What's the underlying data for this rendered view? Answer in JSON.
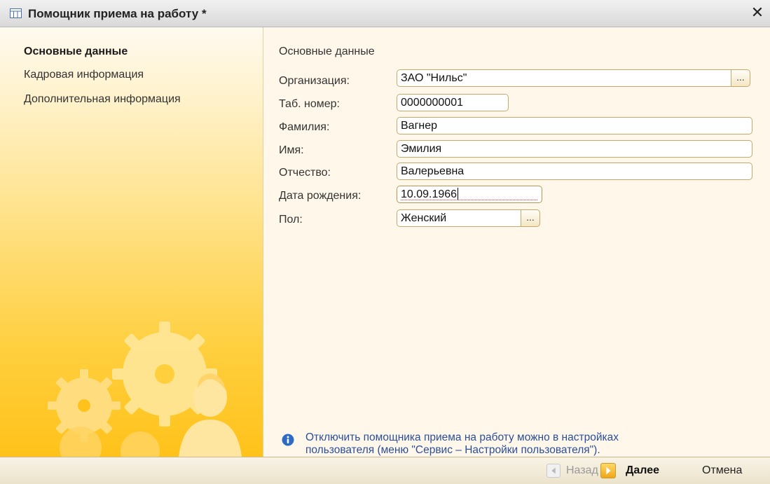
{
  "window": {
    "title": "Помощник приема на работу *",
    "close_icon": "close-icon"
  },
  "sidebar": {
    "items": [
      {
        "label": "Основные данные",
        "active": true
      },
      {
        "label": "Кадровая информация",
        "active": false
      },
      {
        "label": "Дополнительная информация",
        "active": false
      }
    ],
    "gradient_colors": [
      "#fffaf0",
      "#ffc21a"
    ]
  },
  "main": {
    "section_title": "Основные данные",
    "fields": {
      "organization": {
        "label": "Организация:",
        "value": "ЗАО \"Нильс\""
      },
      "tab_number": {
        "label": "Таб. номер:",
        "value": "0000000001"
      },
      "last_name": {
        "label": "Фамилия:",
        "value": "Вагнер"
      },
      "first_name": {
        "label": "Имя:",
        "value": "Эмилия"
      },
      "patronymic": {
        "label": "Отчество:",
        "value": "Валерьевна"
      },
      "birth_date": {
        "label": "Дата рождения:",
        "value": "10.09.1966"
      },
      "gender": {
        "label": "Пол:",
        "value": "Женский"
      }
    },
    "select_button_label": "...",
    "info_text_line1": "Отключить помощника приема на работу можно в настройках",
    "info_text_line2": "пользователя (меню \"Сервис – Настройки пользователя\")."
  },
  "footer": {
    "back_label": "Назад",
    "next_label": "Далее",
    "cancel_label": "Отмена"
  },
  "colors": {
    "accent_yellow": "#ffc21a",
    "info_blue": "#2a4e9b",
    "field_border": "#c6a96a"
  }
}
